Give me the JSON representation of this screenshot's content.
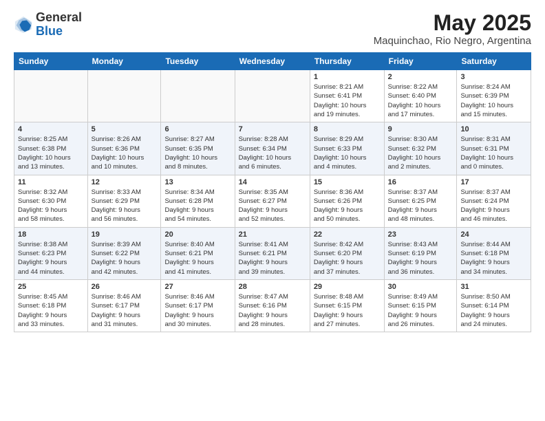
{
  "header": {
    "logo_line1": "General",
    "logo_line2": "Blue",
    "title": "May 2025",
    "subtitle": "Maquinchao, Rio Negro, Argentina"
  },
  "calendar": {
    "days_of_week": [
      "Sunday",
      "Monday",
      "Tuesday",
      "Wednesday",
      "Thursday",
      "Friday",
      "Saturday"
    ],
    "weeks": [
      [
        {
          "day": "",
          "info": ""
        },
        {
          "day": "",
          "info": ""
        },
        {
          "day": "",
          "info": ""
        },
        {
          "day": "",
          "info": ""
        },
        {
          "day": "1",
          "info": "Sunrise: 8:21 AM\nSunset: 6:41 PM\nDaylight: 10 hours\nand 19 minutes."
        },
        {
          "day": "2",
          "info": "Sunrise: 8:22 AM\nSunset: 6:40 PM\nDaylight: 10 hours\nand 17 minutes."
        },
        {
          "day": "3",
          "info": "Sunrise: 8:24 AM\nSunset: 6:39 PM\nDaylight: 10 hours\nand 15 minutes."
        }
      ],
      [
        {
          "day": "4",
          "info": "Sunrise: 8:25 AM\nSunset: 6:38 PM\nDaylight: 10 hours\nand 13 minutes."
        },
        {
          "day": "5",
          "info": "Sunrise: 8:26 AM\nSunset: 6:36 PM\nDaylight: 10 hours\nand 10 minutes."
        },
        {
          "day": "6",
          "info": "Sunrise: 8:27 AM\nSunset: 6:35 PM\nDaylight: 10 hours\nand 8 minutes."
        },
        {
          "day": "7",
          "info": "Sunrise: 8:28 AM\nSunset: 6:34 PM\nDaylight: 10 hours\nand 6 minutes."
        },
        {
          "day": "8",
          "info": "Sunrise: 8:29 AM\nSunset: 6:33 PM\nDaylight: 10 hours\nand 4 minutes."
        },
        {
          "day": "9",
          "info": "Sunrise: 8:30 AM\nSunset: 6:32 PM\nDaylight: 10 hours\nand 2 minutes."
        },
        {
          "day": "10",
          "info": "Sunrise: 8:31 AM\nSunset: 6:31 PM\nDaylight: 10 hours\nand 0 minutes."
        }
      ],
      [
        {
          "day": "11",
          "info": "Sunrise: 8:32 AM\nSunset: 6:30 PM\nDaylight: 9 hours\nand 58 minutes."
        },
        {
          "day": "12",
          "info": "Sunrise: 8:33 AM\nSunset: 6:29 PM\nDaylight: 9 hours\nand 56 minutes."
        },
        {
          "day": "13",
          "info": "Sunrise: 8:34 AM\nSunset: 6:28 PM\nDaylight: 9 hours\nand 54 minutes."
        },
        {
          "day": "14",
          "info": "Sunrise: 8:35 AM\nSunset: 6:27 PM\nDaylight: 9 hours\nand 52 minutes."
        },
        {
          "day": "15",
          "info": "Sunrise: 8:36 AM\nSunset: 6:26 PM\nDaylight: 9 hours\nand 50 minutes."
        },
        {
          "day": "16",
          "info": "Sunrise: 8:37 AM\nSunset: 6:25 PM\nDaylight: 9 hours\nand 48 minutes."
        },
        {
          "day": "17",
          "info": "Sunrise: 8:37 AM\nSunset: 6:24 PM\nDaylight: 9 hours\nand 46 minutes."
        }
      ],
      [
        {
          "day": "18",
          "info": "Sunrise: 8:38 AM\nSunset: 6:23 PM\nDaylight: 9 hours\nand 44 minutes."
        },
        {
          "day": "19",
          "info": "Sunrise: 8:39 AM\nSunset: 6:22 PM\nDaylight: 9 hours\nand 42 minutes."
        },
        {
          "day": "20",
          "info": "Sunrise: 8:40 AM\nSunset: 6:21 PM\nDaylight: 9 hours\nand 41 minutes."
        },
        {
          "day": "21",
          "info": "Sunrise: 8:41 AM\nSunset: 6:21 PM\nDaylight: 9 hours\nand 39 minutes."
        },
        {
          "day": "22",
          "info": "Sunrise: 8:42 AM\nSunset: 6:20 PM\nDaylight: 9 hours\nand 37 minutes."
        },
        {
          "day": "23",
          "info": "Sunrise: 8:43 AM\nSunset: 6:19 PM\nDaylight: 9 hours\nand 36 minutes."
        },
        {
          "day": "24",
          "info": "Sunrise: 8:44 AM\nSunset: 6:18 PM\nDaylight: 9 hours\nand 34 minutes."
        }
      ],
      [
        {
          "day": "25",
          "info": "Sunrise: 8:45 AM\nSunset: 6:18 PM\nDaylight: 9 hours\nand 33 minutes."
        },
        {
          "day": "26",
          "info": "Sunrise: 8:46 AM\nSunset: 6:17 PM\nDaylight: 9 hours\nand 31 minutes."
        },
        {
          "day": "27",
          "info": "Sunrise: 8:46 AM\nSunset: 6:17 PM\nDaylight: 9 hours\nand 30 minutes."
        },
        {
          "day": "28",
          "info": "Sunrise: 8:47 AM\nSunset: 6:16 PM\nDaylight: 9 hours\nand 28 minutes."
        },
        {
          "day": "29",
          "info": "Sunrise: 8:48 AM\nSunset: 6:15 PM\nDaylight: 9 hours\nand 27 minutes."
        },
        {
          "day": "30",
          "info": "Sunrise: 8:49 AM\nSunset: 6:15 PM\nDaylight: 9 hours\nand 26 minutes."
        },
        {
          "day": "31",
          "info": "Sunrise: 8:50 AM\nSunset: 6:14 PM\nDaylight: 9 hours\nand 24 minutes."
        }
      ]
    ]
  }
}
